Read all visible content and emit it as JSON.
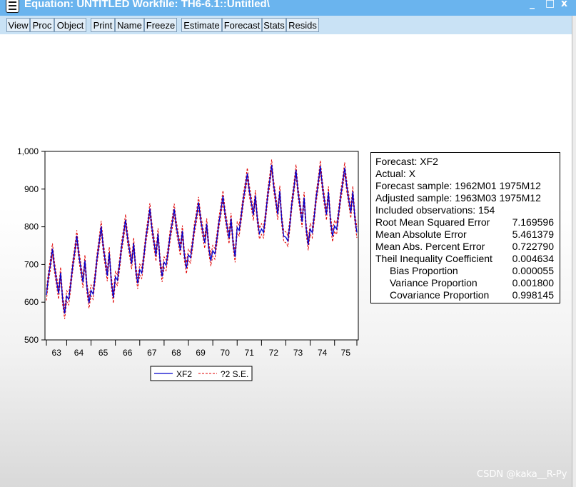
{
  "window": {
    "title": "Equation: UNTITLED   Workfile: TH6-6.1::Untitled\\",
    "minimize": "_",
    "restore": "□",
    "close": "x"
  },
  "toolbar": {
    "buttons": [
      "View",
      "Proc",
      "Object",
      "Print",
      "Name",
      "Freeze",
      "Estimate",
      "Forecast",
      "Stats",
      "Resids"
    ]
  },
  "forecast_stats": {
    "forecast": "Forecast: XF2",
    "actual": "Actual: X",
    "forecast_sample": "Forecast sample: 1962M01 1975M12",
    "adjusted_sample": "Adjusted sample: 1963M03 1975M12",
    "included_observations": "Included observations: 154",
    "rows": [
      {
        "label": "Root Mean Squared Error",
        "value": "7.169596",
        "indent": false
      },
      {
        "label": "Mean Absolute Error",
        "value": "5.461379",
        "indent": false
      },
      {
        "label": "Mean Abs. Percent Error",
        "value": "0.722790",
        "indent": false
      },
      {
        "label": "Theil Inequality Coefficient",
        "value": "0.004634",
        "indent": false
      },
      {
        "label": "Bias Proportion",
        "value": "0.000055",
        "indent": true
      },
      {
        "label": "Variance Proportion",
        "value": "0.001800",
        "indent": true
      },
      {
        "label": "Covariance Proportion",
        "value": "0.998145",
        "indent": true
      }
    ]
  },
  "chart_data": {
    "type": "line",
    "title": "",
    "xlabel": "",
    "ylabel": "",
    "x_range": [
      "1963M03",
      "1975M12"
    ],
    "ylim": [
      500,
      1000
    ],
    "y_ticks": [
      500,
      600,
      700,
      800,
      900,
      1000
    ],
    "y_tick_labels": [
      "500",
      "600",
      "700",
      "800",
      "900",
      "1,000"
    ],
    "x_tick_labels": [
      "63",
      "64",
      "65",
      "66",
      "67",
      "68",
      "69",
      "70",
      "71",
      "72",
      "73",
      "74",
      "75"
    ],
    "grid": false,
    "legend_position": "bottom-center",
    "band_width": 14.3,
    "annual_peaks": [
      745,
      780,
      805,
      822,
      852,
      850,
      868,
      885,
      945,
      968,
      955,
      965,
      960
    ],
    "annual_troughs": [
      570,
      598,
      612,
      650,
      668,
      690,
      710,
      720,
      782,
      775,
      752,
      775,
      785
    ],
    "series": [
      {
        "name": "XF2",
        "color": "#0000cc",
        "style": "solid"
      },
      {
        "name": "?2 S.E.",
        "color": "#e00000",
        "style": "dashed"
      }
    ]
  },
  "watermark": "CSDN @kaka__R-Py"
}
